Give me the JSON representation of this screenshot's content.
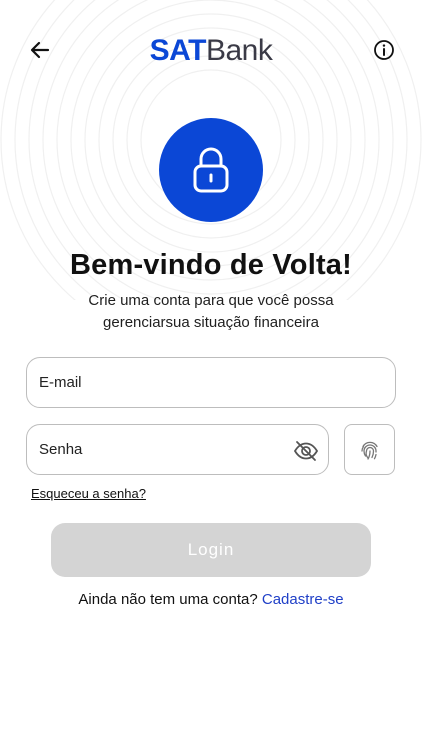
{
  "header": {
    "logo": {
      "sat": "SAT",
      "bank": "Bank"
    },
    "back_icon": "arrow-left-icon",
    "info_icon": "info-icon"
  },
  "hero": {
    "icon": "lock-icon",
    "title": "Bem-vindo de Volta!",
    "subtitle_line1": "Crie uma conta para que você possa",
    "subtitle_line2": "gerenciarsua situação financeira"
  },
  "form": {
    "email": {
      "placeholder": "E-mail",
      "value": ""
    },
    "password": {
      "placeholder": "Senha",
      "value": "",
      "toggle_icon": "eye-off-icon"
    },
    "biometric_icon": "fingerprint-icon",
    "forgot_label": "Esqueceu a senha?",
    "login_label": "Login",
    "login_enabled": false
  },
  "footer": {
    "prompt": "Ainda não tem uma conta?",
    "signup_label": "Cadastre-se"
  },
  "colors": {
    "brand_primary": "#0b47d6",
    "brand_dark": "#3a3a46",
    "button_disabled": "#d4d4d4",
    "link": "#1f3fc7",
    "border": "#bdbdbd"
  }
}
